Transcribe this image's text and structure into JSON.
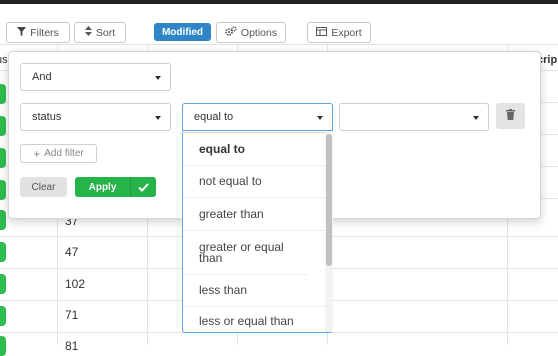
{
  "toolbar": {
    "filters_label": "Filters",
    "sort_label": "Sort",
    "modified_badge": "Modified",
    "options_label": "Options",
    "export_label": "Export",
    "icons": [
      "filter-icon",
      "sort-icon",
      "gear-icon",
      "table-icon"
    ]
  },
  "grid": {
    "header_left_fragment": "us",
    "header_right_fragment": "crip",
    "visible_values": [
      "37",
      "47",
      "102",
      "71",
      "81"
    ]
  },
  "filter_panel": {
    "conjunction": "And",
    "field": "status",
    "operator": "equal to",
    "value": "",
    "add_filter_label": "Add filter",
    "clear_label": "Clear",
    "apply_label": "Apply",
    "operator_options": [
      "equal to",
      "not equal to",
      "greater than",
      "greater or equal than",
      "less than",
      "less or equal than"
    ]
  },
  "colors": {
    "accent_blue": "#2e86c9",
    "apply_green": "#25b34a",
    "status_green": "#2ebd4e",
    "focus_border": "#5aa6e6"
  }
}
